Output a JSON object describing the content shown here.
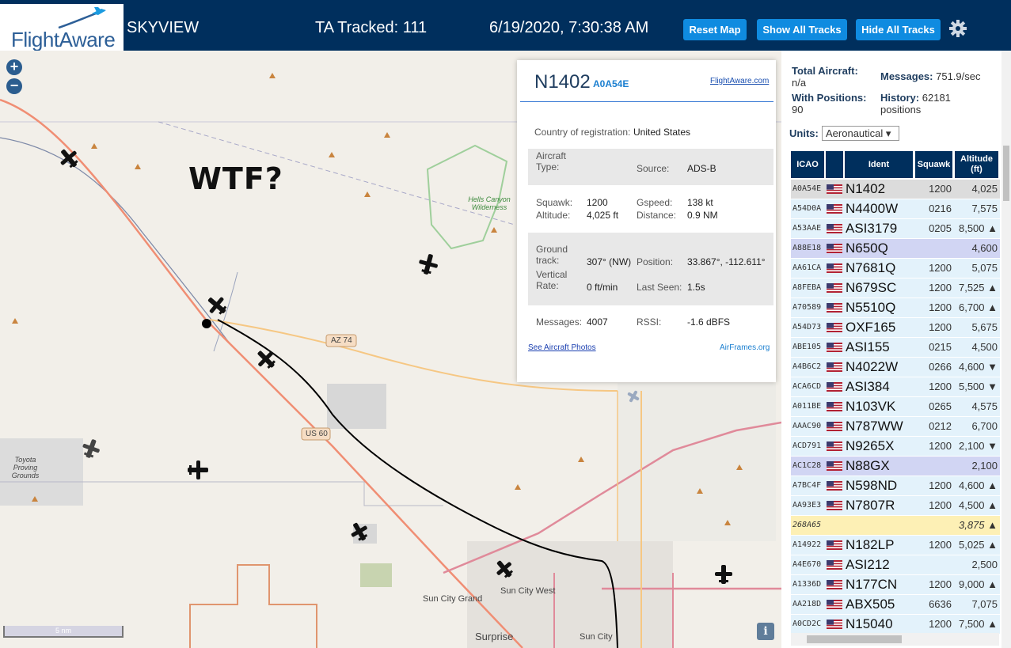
{
  "header": {
    "brand": "FlightAware",
    "app_name": "SKYVIEW",
    "tracked": "TA Tracked: 111",
    "datetime": "6/19/2020, 7:30:38 AM",
    "buttons": {
      "reset": "Reset Map",
      "show_all": "Show All Tracks",
      "hide_all": "Hide All Tracks"
    },
    "settings_icon": "gear-icon"
  },
  "map": {
    "zoom_in": "+",
    "zoom_out": "−",
    "scale": "5 nm",
    "annotation": "WTF?",
    "info": "i",
    "labels": {
      "hells_canyon": "Hells Canyon Wilderness",
      "az74": "AZ 74",
      "us60": "US 60",
      "toyota": "Toyota Proving Grounds",
      "sun_city_grand": "Sun City Grand",
      "sun_city_west": "Sun City West",
      "surprise": "Surprise",
      "sun_city": "Sun City"
    }
  },
  "popup": {
    "registration": "N1402",
    "hex": "A0A54E",
    "fa_link": "FlightAware.com",
    "country_label": "Country of registration:",
    "country_value": "United States",
    "aircraft_type_label": "Aircraft Type:",
    "source_label": "Source:",
    "source_value": "ADS-B",
    "squawk_label": "Squawk:",
    "squawk_value": "1200",
    "gspeed_label": "Gspeed:",
    "gspeed_value": "138 kt",
    "altitude_label": "Altitude:",
    "altitude_value": "4,025 ft",
    "distance_label": "Distance:",
    "distance_value": "0.9 NM",
    "ground_track_label": "Ground track:",
    "ground_track_value": "307° (NW)",
    "position_label": "Position:",
    "position_value": "33.867°, -112.611°",
    "vertical_rate_label": "Vertical Rate:",
    "vertical_rate_value": "0 ft/min",
    "last_seen_label": "Last Seen:",
    "last_seen_value": "1.5s",
    "messages_label": "Messages:",
    "messages_value": "4007",
    "rssi_label": "RSSI:",
    "rssi_value": "-1.6 dBFS",
    "photos_link": "See Aircraft Photos",
    "airframes_link": "AirFrames.org"
  },
  "sidebar": {
    "total_aircraft_label": "Total Aircraft:",
    "total_aircraft_value": "n/a",
    "messages_label": "Messages:",
    "messages_value": "751.9/sec",
    "with_positions_label": "With Positions:",
    "with_positions_value": "90",
    "history_label": "History:",
    "history_value": "62181",
    "history_unit": "positions",
    "units_label": "Units:",
    "units_value": "Aeronautical",
    "columns": [
      "ICAO",
      "Ident",
      "Squawk",
      "Altitude (ft)"
    ],
    "rows": [
      {
        "icao": "A0A54E",
        "ident": "N1402",
        "squawk": "1200",
        "alt": "4,025",
        "bg": "#dcdcdc"
      },
      {
        "icao": "A54D0A",
        "ident": "N4400W",
        "squawk": "0216",
        "alt": "7,575",
        "bg": "#e3f2fb"
      },
      {
        "icao": "A53AAE",
        "ident": "ASI3179",
        "squawk": "0205",
        "alt": "8,500 ▲",
        "bg": "#e3f2fb"
      },
      {
        "icao": "A88E18",
        "ident": "N650Q",
        "squawk": "",
        "alt": "4,600",
        "bg": "#d1d5f3"
      },
      {
        "icao": "AA61CA",
        "ident": "N7681Q",
        "squawk": "1200",
        "alt": "5,075",
        "bg": "#e3f2fb"
      },
      {
        "icao": "A8FEBA",
        "ident": "N679SC",
        "squawk": "1200",
        "alt": "7,525 ▲",
        "bg": "#e3f2fb"
      },
      {
        "icao": "A70589",
        "ident": "N5510Q",
        "squawk": "1200",
        "alt": "6,700 ▲",
        "bg": "#e3f2fb"
      },
      {
        "icao": "A54D73",
        "ident": "OXF165",
        "squawk": "1200",
        "alt": "5,675",
        "bg": "#e3f2fb"
      },
      {
        "icao": "ABE105",
        "ident": "ASI155",
        "squawk": "0215",
        "alt": "4,500",
        "bg": "#e3f2fb"
      },
      {
        "icao": "A4B6C2",
        "ident": "N4022W",
        "squawk": "0266",
        "alt": "4,600 ▼",
        "bg": "#e3f2fb"
      },
      {
        "icao": "ACA6CD",
        "ident": "ASI384",
        "squawk": "1200",
        "alt": "5,500 ▼",
        "bg": "#e3f2fb"
      },
      {
        "icao": "A011BE",
        "ident": "N103VK",
        "squawk": "0265",
        "alt": "4,575",
        "bg": "#e3f2fb"
      },
      {
        "icao": "AAAC90",
        "ident": "N787WW",
        "squawk": "0212",
        "alt": "6,700",
        "bg": "#e3f2fb"
      },
      {
        "icao": "ACD791",
        "ident": "N9265X",
        "squawk": "1200",
        "alt": "2,100 ▼",
        "bg": "#e3f2fb"
      },
      {
        "icao": "AC1C28",
        "ident": "N88GX",
        "squawk": "",
        "alt": "2,100",
        "bg": "#d1d5f3"
      },
      {
        "icao": "A7BC4F",
        "ident": "N598ND",
        "squawk": "1200",
        "alt": "4,600 ▲",
        "bg": "#e3f2fb"
      },
      {
        "icao": "AA93E3",
        "ident": "N7807R",
        "squawk": "1200",
        "alt": "4,500 ▲",
        "bg": "#e3f2fb"
      },
      {
        "icao": "268A65",
        "ident": "",
        "squawk": "",
        "alt": "3,875 ▲",
        "bg": "#fdf0b5"
      },
      {
        "icao": "A14922",
        "ident": "N182LP",
        "squawk": "1200",
        "alt": "5,025 ▲",
        "bg": "#e3f2fb"
      },
      {
        "icao": "A4E670",
        "ident": "ASI212",
        "squawk": "",
        "alt": "2,500",
        "bg": "#e3f2fb"
      },
      {
        "icao": "A1336D",
        "ident": "N177CN",
        "squawk": "1200",
        "alt": "9,000 ▲",
        "bg": "#e3f2fb"
      },
      {
        "icao": "AA218D",
        "ident": "ABX505",
        "squawk": "6636",
        "alt": "7,075",
        "bg": "#e3f2fb"
      },
      {
        "icao": "A0CD2C",
        "ident": "N15040",
        "squawk": "1200",
        "alt": "7,500 ▲",
        "bg": "#e3f2fb"
      }
    ]
  },
  "colors": {
    "header_bg": "#002f5d",
    "button_blue": "#0f8be0",
    "accent_blue": "#1b7fd0",
    "row_blue": "#e3f2fb",
    "row_selected": "#dcdcdc",
    "row_noicao": "#d1d5f3",
    "row_nonus": "#fdf0b5"
  }
}
